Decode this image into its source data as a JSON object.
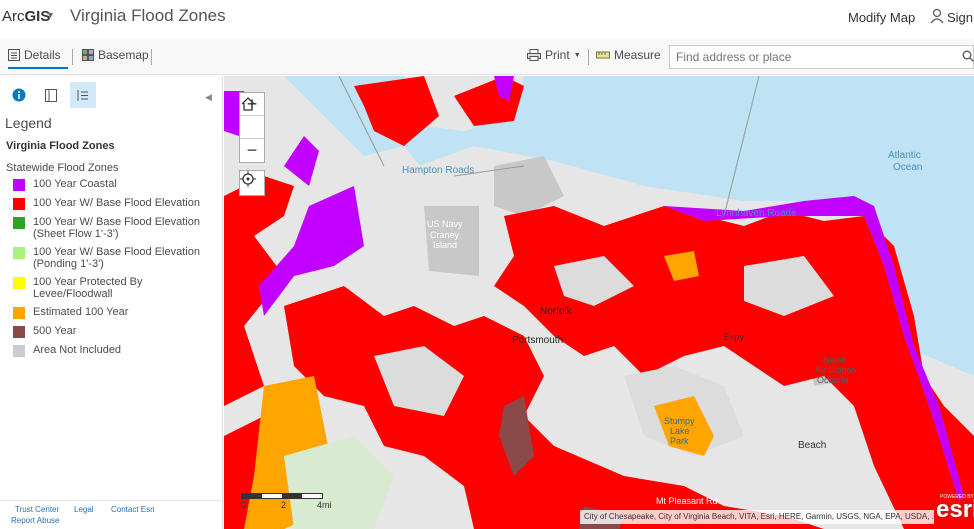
{
  "header": {
    "logo_arc": "Arc",
    "logo_gis": "GIS",
    "title": "Virginia Flood Zones",
    "modify_map": "Modify Map",
    "sign_in": "Sign"
  },
  "toolbar": {
    "details": "Details",
    "basemap": "Basemap",
    "print": "Print",
    "measure": "Measure",
    "search_placeholder": "Find address or place"
  },
  "sidebar": {
    "legend_heading": "Legend",
    "layer_title": "Virginia Flood Zones",
    "layer_subtitle": "Statewide Flood Zones",
    "legend_items": [
      {
        "label": "100 Year Coastal",
        "color": "#c200ff"
      },
      {
        "label": "100 Year W/ Base Flood Elevation",
        "color": "#ff0000"
      },
      {
        "label": "100 Year W/ Base Flood Elevation (Sheet Flow 1'-3')",
        "color": "#33a02c"
      },
      {
        "label": "100 Year W/ Base Flood Elevation (Ponding 1'-3')",
        "color": "#a6f27a"
      },
      {
        "label": "100 Year Protected By Levee/Floodwall",
        "color": "#ffff00"
      },
      {
        "label": "Estimated 100 Year",
        "color": "#ffa500"
      },
      {
        "label": "500 Year",
        "color": "#8b4a4a"
      },
      {
        "label": "Area Not Included",
        "color": "#cccccc"
      }
    ],
    "footer": {
      "trust_center": "Trust Center",
      "legal": "Legal",
      "contact": "Contact Esri",
      "report_abuse": "Report Abuse"
    }
  },
  "map": {
    "labels": {
      "hampton_roads": "Hampton Roads",
      "atlantic_1": "Atlantic",
      "atlantic_2": "Ocean",
      "lynnhaven": "Lynnhaven Roads",
      "navy_1": "US Navy",
      "navy_2": "Craney",
      "navy_3": "Island",
      "norfolk": "Norfolk",
      "portsmouth": "Portsmouth",
      "naval_1": "Naval",
      "naval_2": "Air Station",
      "naval_3": "Oceana",
      "stumpy_1": "Stumpy",
      "stumpy_2": "Lake",
      "stumpy_3": "Park",
      "beach": "Beach",
      "pleasant": "Mt Pleasant Rd",
      "expy": "Expy"
    },
    "scale": {
      "l0": "0",
      "l2": "2",
      "l4": "4mi"
    },
    "attribution": "City of Chesapeake, City of Virginia Beach, VITA, Esri, HERE, Garmin, USGS, NGA, EPA, USDA, ...",
    "esri_logo": "esri",
    "powered_by": "POWERED BY",
    "colors": {
      "water": "#bfe3f4",
      "land": "#ececec",
      "flood_red": "#ff0000",
      "coastal_purple": "#c200ff",
      "estimated_orange": "#ffa500",
      "not_included_gray": "#c8c8c8"
    }
  }
}
